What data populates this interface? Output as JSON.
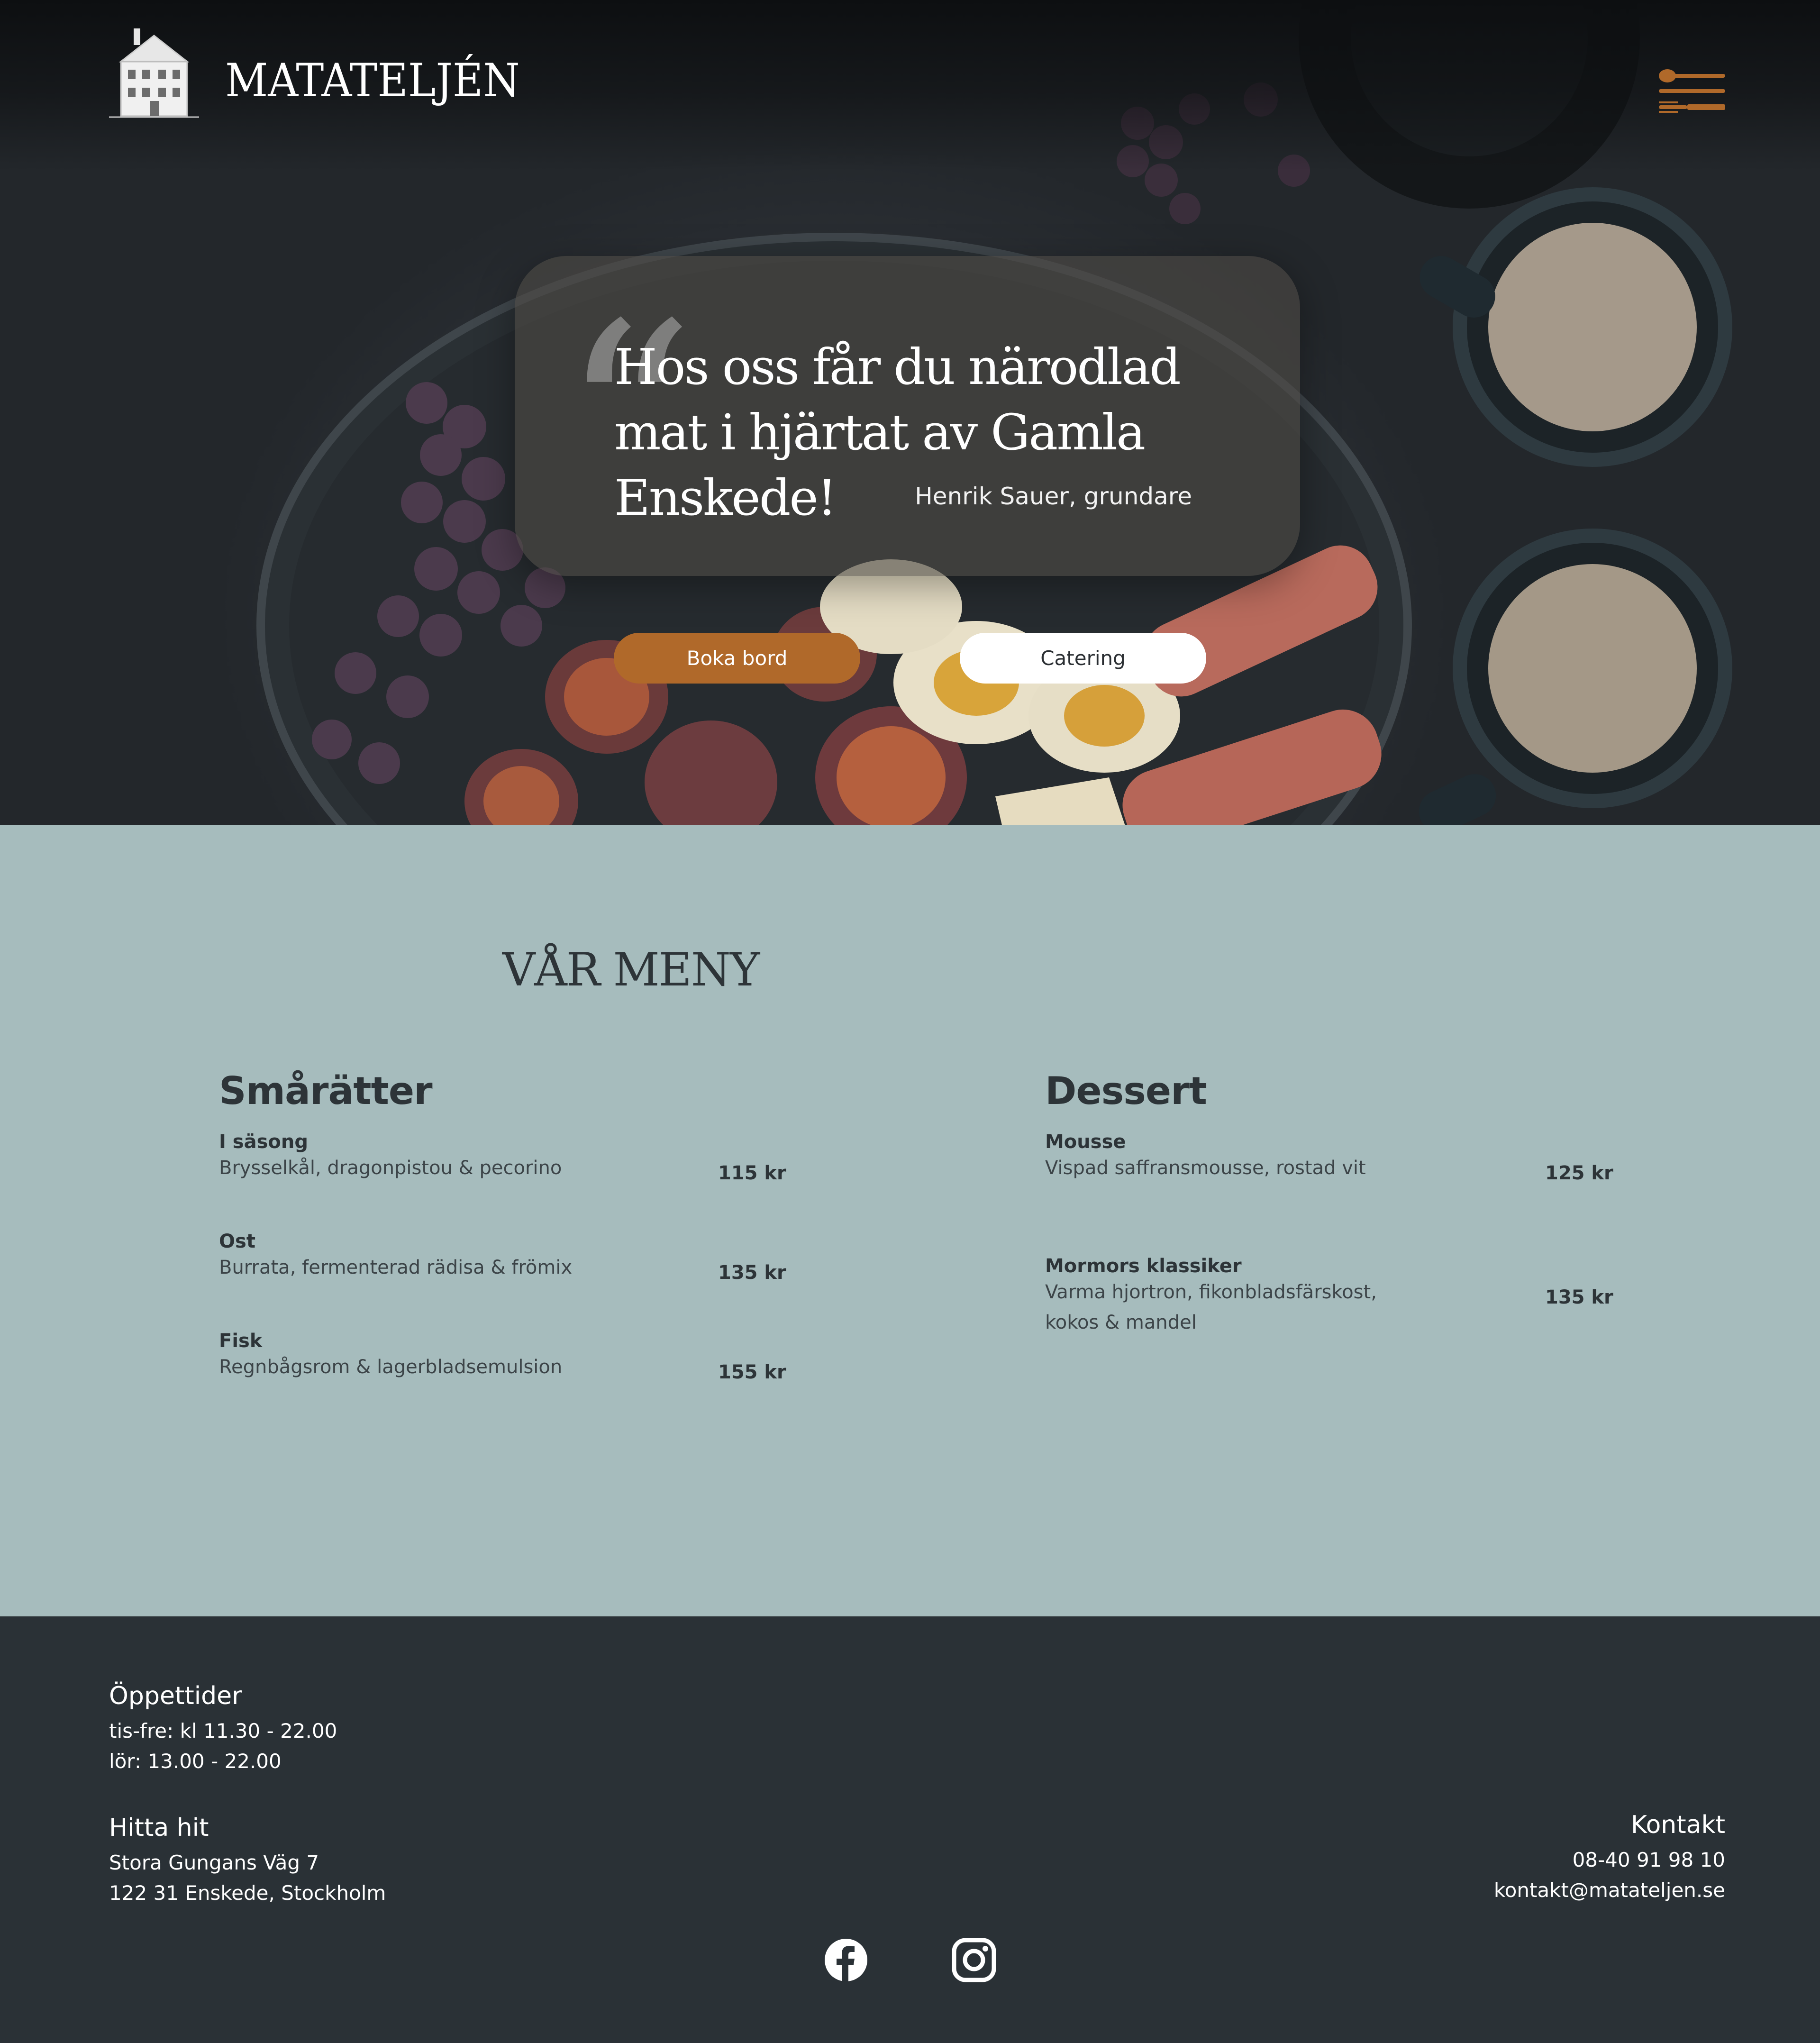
{
  "brand": {
    "name": "MATATELJÉN"
  },
  "header": {
    "menu_icon": "cutlery-menu-icon"
  },
  "hero": {
    "quote": "Hos oss får du närodlad mat i hjärtat av Gamla Enskede!",
    "quote_mark": "“",
    "author": "Henrik Sauer, grundare",
    "buttons": {
      "book": "Boka bord",
      "catering": "Catering"
    }
  },
  "menu": {
    "title": "VÅR MENY",
    "categories": [
      {
        "title": "Smårätter",
        "items": [
          {
            "name": "I säsong",
            "description": "Brysselkål, dragonpistou & pecorino",
            "price": "115 kr"
          },
          {
            "name": "Ost",
            "description": "Burrata, fermenterad rädisa & frömix",
            "price": "135 kr"
          },
          {
            "name": "Fisk",
            "description": "Regnbågsrom & lagerbladsemulsion",
            "price": "155 kr"
          }
        ]
      },
      {
        "title": "Dessert",
        "items": [
          {
            "name": "Mousse",
            "description": "Vispad saffransmousse, rostad vit",
            "price": "125 kr"
          },
          {
            "name": "Mormors klassiker",
            "description": "Varma hjortron, fikonbladsfärskost, kokos & mandel",
            "price": "135 kr"
          }
        ]
      }
    ]
  },
  "footer": {
    "hours": {
      "title": "Öppettider",
      "lines": [
        "tis-fre: kl 11.30 - 22.00",
        "lör: 13.00 - 22.00"
      ]
    },
    "location": {
      "title": "Hitta hit",
      "lines": [
        "Stora Gungans Väg 7",
        "122 31 Enskede, Stockholm"
      ]
    },
    "contact": {
      "title": "Kontakt",
      "lines": [
        "08-40 91 98 10",
        "kontakt@matateljen.se"
      ]
    },
    "social": [
      "facebook-icon",
      "instagram-icon"
    ]
  },
  "colors": {
    "accent": "#b0692a",
    "menu_bg": "#a6bcbd",
    "footer_bg": "#2a3136",
    "text_dark": "#2d3438"
  }
}
